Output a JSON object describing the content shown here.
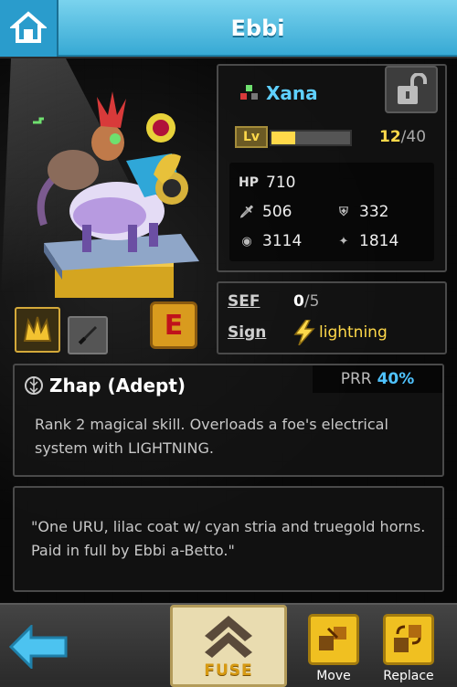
{
  "header": {
    "title": "Ebbi",
    "home_icon": "home-icon"
  },
  "unit": {
    "name": "Xana",
    "level_label": "Lv",
    "level": "12",
    "level_max": "/40",
    "level_progress": 0.3,
    "stats": {
      "hp_label": "HP",
      "hp": "710",
      "attack": "506",
      "defense": "332",
      "magic": "3114",
      "speed": "1814"
    },
    "sef_label": "SEF",
    "sef_value": "0",
    "sef_max": "/5",
    "sign_label": "Sign",
    "sign_value": "lightning",
    "badge_letter": "E"
  },
  "skill": {
    "name": "Zhap (Adept)",
    "prr_label": "PRR",
    "prr_value": "40%",
    "description": "Rank 2 magical skill. Overloads a foe's electrical system with LIGHTNING."
  },
  "lore": {
    "quote": "\"One URU, lilac coat w/ cyan stria and truegold horns. Paid in full by Ebbi a-Betto.\""
  },
  "footer": {
    "fuse_label": "FUSE",
    "move_label": "Move",
    "replace_label": "Replace"
  },
  "colors": {
    "accent": "#37a9d4",
    "name": "#5fd0ff",
    "gold": "#ffd94a",
    "prr": "#4fc3ff"
  }
}
